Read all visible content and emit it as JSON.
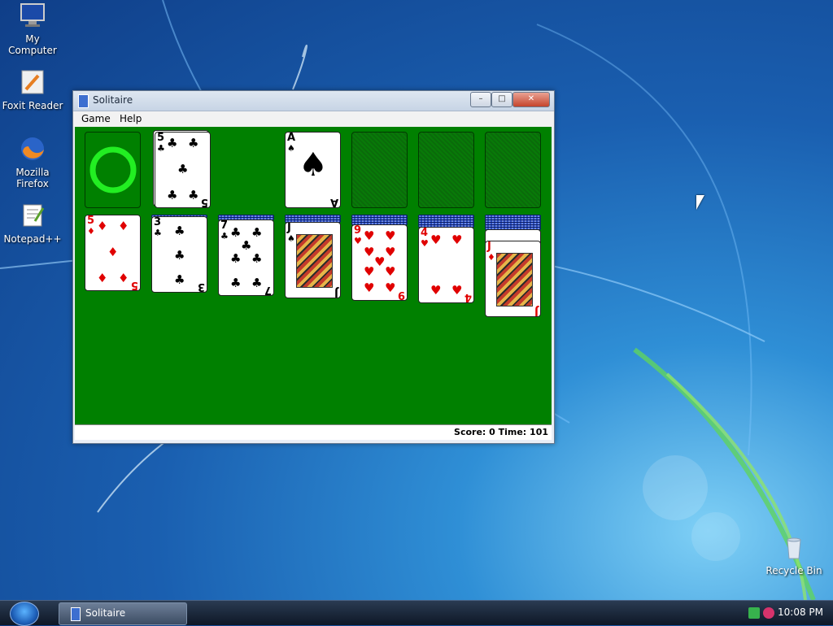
{
  "desktop": {
    "icons": [
      {
        "label": "My Computer",
        "icon": "monitor-icon"
      },
      {
        "label": "Foxit Reader",
        "icon": "pdf-reader-icon"
      },
      {
        "label": "Mozilla Firefox",
        "icon": "firefox-icon"
      },
      {
        "label": "Notepad++",
        "icon": "notepad-icon"
      },
      {
        "label": "Recycle Bin",
        "icon": "recycle-bin-icon"
      }
    ]
  },
  "window": {
    "title": "Solitaire",
    "controls": {
      "minimize": "–",
      "maximize": "□",
      "close": "✕"
    },
    "menu": [
      "Game",
      "Help"
    ],
    "status": "Score: 0 Time: 101",
    "stock_symbol": "○",
    "waste": {
      "rank": "5",
      "suit": "♣"
    },
    "foundations": [
      {
        "rank": "A",
        "suit": "♠"
      }
    ],
    "tableau": [
      {
        "rank": "5",
        "suit": "♦",
        "color": "red"
      },
      {
        "rank": "3",
        "suit": "♣",
        "color": "black"
      },
      {
        "rank": "7",
        "suit": "♣",
        "color": "black"
      },
      {
        "rank": "J",
        "suit": "♠",
        "color": "black"
      },
      {
        "rank": "9",
        "suit": "♥",
        "color": "red"
      },
      {
        "rank": "4",
        "suit": "♥",
        "color": "red"
      },
      {
        "rank": "J",
        "suit": "♦",
        "color": "red"
      }
    ]
  },
  "taskbar": {
    "start_icon": "windows-start-icon",
    "task": "Solitaire",
    "clock": "10:08 PM"
  },
  "colors": {
    "felt": "#008000",
    "red_suit": "#e00000"
  }
}
